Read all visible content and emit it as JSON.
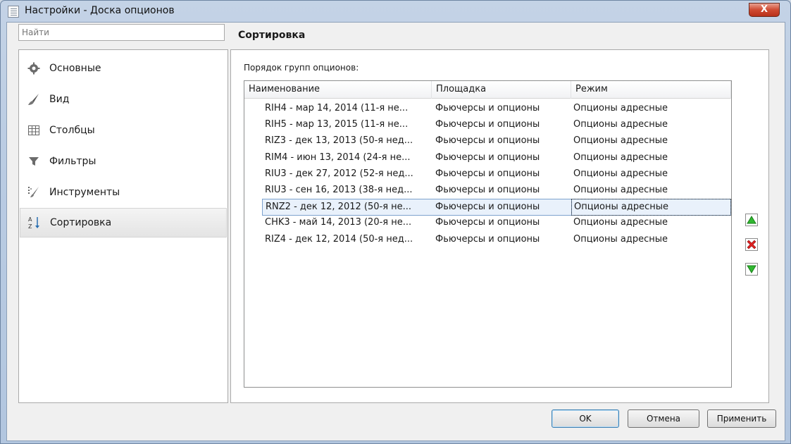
{
  "window": {
    "title": "Настройки - Доска опционов",
    "close_label": "X"
  },
  "search": {
    "placeholder": "Найти"
  },
  "sidebar": {
    "items": [
      {
        "label": "Основные",
        "icon": "gear-icon"
      },
      {
        "label": "Вид",
        "icon": "brush-icon"
      },
      {
        "label": "Столбцы",
        "icon": "columns-icon"
      },
      {
        "label": "Фильтры",
        "icon": "filter-icon"
      },
      {
        "label": "Инструменты",
        "icon": "tools-icon"
      },
      {
        "label": "Сортировка",
        "icon": "sort-az-icon"
      }
    ],
    "selected_index": 5
  },
  "main": {
    "section_title": "Сортировка",
    "group_label": "Порядок групп опционов:",
    "columns": [
      "Наименование",
      "Площадка",
      "Режим"
    ],
    "rows": [
      {
        "name": "RIH4 - мар 14, 2014 (11-я не...",
        "venue": "Фьючерсы и опционы",
        "mode": "Опционы адресные"
      },
      {
        "name": "RIH5 - мар 13, 2015 (11-я не...",
        "venue": "Фьючерсы и опционы",
        "mode": "Опционы адресные"
      },
      {
        "name": "RIZ3 - дек 13, 2013 (50-я нед...",
        "venue": "Фьючерсы и опционы",
        "mode": "Опционы адресные"
      },
      {
        "name": "RIM4 - июн 13, 2014 (24-я не...",
        "venue": "Фьючерсы и опционы",
        "mode": "Опционы адресные"
      },
      {
        "name": "RIU3 - дек 27, 2012 (52-я нед...",
        "venue": "Фьючерсы и опционы",
        "mode": "Опционы адресные"
      },
      {
        "name": "RIU3 - сен 16, 2013 (38-я нед...",
        "venue": "Фьючерсы и опционы",
        "mode": "Опционы адресные"
      },
      {
        "name": "RNZ2 - дек 12, 2012 (50-я не...",
        "venue": "Фьючерсы и опционы",
        "mode": "Опционы адресные"
      },
      {
        "name": "CHK3 - май 14, 2013 (20-я не...",
        "venue": "Фьючерсы и опционы",
        "mode": "Опционы адресные"
      },
      {
        "name": "RIZ4 - дек 12, 2014 (50-я нед...",
        "venue": "Фьючерсы и опционы",
        "mode": "Опционы адресные"
      }
    ],
    "selected_row": 6
  },
  "buttons": {
    "ok": "OK",
    "cancel": "Отмена",
    "apply": "Применить"
  },
  "colors": {
    "move_up": "#2fb82f",
    "delete": "#e02020",
    "move_down": "#2fb82f",
    "selection_border": "#7da2ce"
  }
}
